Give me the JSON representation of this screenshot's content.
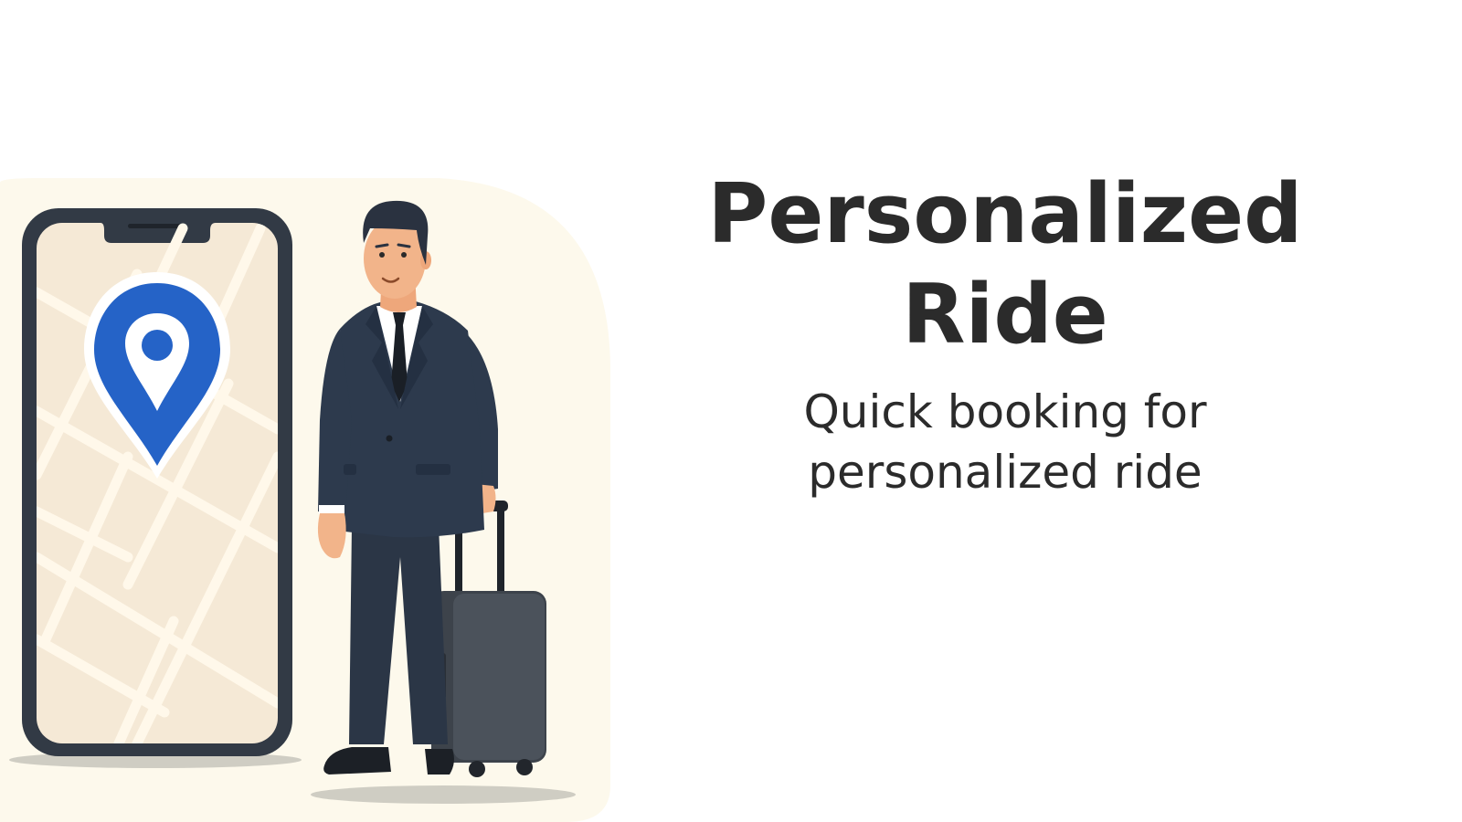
{
  "hero": {
    "title": "Personalized Ride",
    "subtitle": "Quick booking for personalized ride"
  },
  "illustration": {
    "phone_icon": "smartphone-map-icon",
    "pin_icon": "location-pin-icon",
    "person_icon": "businessman-traveler-icon",
    "luggage_icon": "rolling-suitcase-icon"
  },
  "colors": {
    "background": "#ffffff",
    "illustration_backdrop": "#fdf9ec",
    "map_fill": "#f5e9d6",
    "map_roads": "#fff8ea",
    "phone_frame": "#323a45",
    "pin_blue": "#2563c7",
    "suit": "#2d3a4d",
    "suitcase": "#454c55",
    "text": "#2b2b2b"
  }
}
